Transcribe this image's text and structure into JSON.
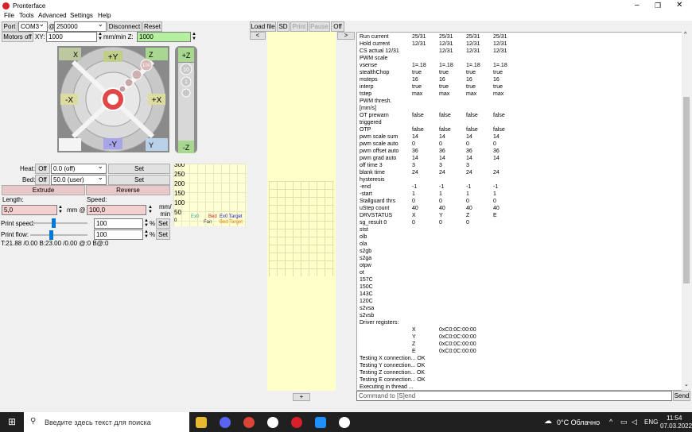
{
  "window": {
    "title": "Pronterface"
  },
  "menu": [
    "File",
    "Tools",
    "Advanced",
    "Settings",
    "Help"
  ],
  "toolbar": {
    "port_label": "Port",
    "port_value": "COM3",
    "baud_at": "@",
    "baud_value": "250000",
    "disconnect": "Disconnect",
    "reset": "Reset",
    "load_file": "Load file",
    "sd": "SD",
    "print": "Print",
    "pause": "Pause",
    "off": "Off"
  },
  "motion": {
    "motors_off": "Motors off",
    "xy_label": "XY:",
    "xy_feed": "1000",
    "z_unit": "mm/min Z:",
    "z_feed": "1000",
    "btn_home_x": "X",
    "btn_home_z": "Z",
    "btn_home_y": "Y",
    "btn_plus_y": "+Y",
    "btn_minus_y": "-Y",
    "btn_plus_x": "+X",
    "btn_minus_x": "-X",
    "btn_plus_z": "+Z",
    "btn_minus_z": "-Z",
    "steps": [
      "100",
      "10",
      "1",
      "0.1"
    ],
    "z_steps": [
      "10",
      "1",
      "0.1"
    ]
  },
  "temp": {
    "heat_label": "Heat:",
    "heat_off": "Off",
    "heat_value": "0.0 (off)",
    "heat_set": "Set",
    "bed_label": "Bed:",
    "bed_off": "Off",
    "bed_value": "50.0 (user)",
    "bed_set": "Set",
    "extrude": "Extrude",
    "reverse": "Reverse",
    "length_label": "Length:",
    "speed_label": "Speed:",
    "length_value": "5,0",
    "mm_at": "mm @",
    "speed_value": "100,0",
    "speed_unit_1": "mm/",
    "speed_unit_2": "min",
    "print_speed_label": "Print speed:",
    "print_speed_value": "100",
    "print_flow_label": "Print flow:",
    "print_flow_value": "100",
    "pct": "%",
    "set": "Set",
    "status": "T:21.88 /0.00 B:23.00 /0.00 @:0 B@:0"
  },
  "graph": {
    "yticks": [
      "300",
      "250",
      "200",
      "150",
      "100",
      "50",
      "0"
    ],
    "legend": [
      "Ex0",
      "Bed",
      "Ex0 Target",
      "Fan",
      "Bed Target"
    ]
  },
  "viewer": {
    "left_arrow": "<",
    "right_arrow": ">",
    "plus": "+"
  },
  "log": {
    "lines": [
      [
        "Run current",
        "25/31",
        "25/31",
        "25/31",
        "25/31"
      ],
      [
        "Hold current",
        "12/31",
        "12/31",
        "12/31",
        "12/31"
      ],
      [
        "CS actual  12/31",
        "",
        "12/31",
        "12/31",
        "12/31"
      ],
      [
        "PWM scale",
        "",
        "",
        "",
        ""
      ],
      [
        "vsense",
        "1=.18",
        "1=.18",
        "1=.18",
        "1=.18"
      ],
      [
        "stealthChop",
        "true",
        "true",
        "true",
        "true"
      ],
      [
        "msteps",
        "16",
        "16",
        "16",
        "16"
      ],
      [
        "interp",
        "true",
        "true",
        "true",
        "true"
      ],
      [
        "tstep",
        "max",
        "max",
        "max",
        "max"
      ],
      [
        "PWM thresh.",
        "",
        "",
        "",
        ""
      ],
      [
        "[mm/s]",
        "",
        "",
        "",
        ""
      ],
      [
        "OT prewarn",
        "false",
        "false",
        "false",
        "false"
      ],
      [
        "triggered",
        "",
        "",
        "",
        ""
      ],
      [
        " OTP",
        "false",
        "false",
        "false",
        "false"
      ],
      [
        "pwm scale sum",
        "14",
        "14",
        "14",
        "14"
      ],
      [
        "pwm scale auto",
        "0",
        "0",
        "0",
        "0"
      ],
      [
        "pwm offset auto",
        "36",
        "36",
        "36",
        "36"
      ],
      [
        "pwm grad auto",
        "14",
        "14",
        "14",
        "14"
      ],
      [
        "off time   3",
        "3",
        "3",
        "3",
        ""
      ],
      [
        "blank time",
        "24",
        "24",
        "24",
        "24"
      ],
      [
        "hysteresis",
        "",
        "",
        "",
        ""
      ],
      [
        " -end",
        "-1",
        "-1",
        "-1",
        "-1"
      ],
      [
        " -start",
        "1",
        "1",
        "1",
        "1"
      ],
      [
        "Stallguard thrs",
        "0",
        "0",
        "0",
        "0"
      ],
      [
        "uStep count",
        "40",
        "40",
        "40",
        "40"
      ],
      [
        "DRVSTATUS",
        "X",
        "Y",
        "Z",
        "E"
      ],
      [
        "sg_result  0",
        "0",
        "0",
        "0",
        ""
      ],
      [
        "stst",
        "",
        "",
        "",
        ""
      ],
      [
        "olb",
        "",
        "",
        "",
        ""
      ],
      [
        "ola",
        "",
        "",
        "",
        ""
      ],
      [
        "s2gb",
        "",
        "",
        "",
        ""
      ],
      [
        "s2ga",
        "",
        "",
        "",
        ""
      ],
      [
        "otpw",
        "",
        "",
        "",
        ""
      ],
      [
        "ot",
        "",
        "",
        "",
        ""
      ],
      [
        "157C",
        "",
        "",
        "",
        ""
      ],
      [
        "150C",
        "",
        "",
        "",
        ""
      ],
      [
        "143C",
        "",
        "",
        "",
        ""
      ],
      [
        "120C",
        "",
        "",
        "",
        ""
      ],
      [
        "s2vsa",
        "",
        "",
        "",
        ""
      ],
      [
        "s2vsb",
        "",
        "",
        "",
        ""
      ],
      [
        "Driver registers:",
        "",
        "",
        "",
        ""
      ],
      [
        "",
        "X",
        "0xC0:0C:00:00",
        "",
        ""
      ],
      [
        "",
        "Y",
        "0xC0:0C:00:00",
        "",
        ""
      ],
      [
        "",
        "Z",
        "0xC0:0C:00:00",
        "",
        ""
      ],
      [
        "",
        "E",
        "0xC0:0C:00:00",
        "",
        ""
      ],
      [
        "Testing X connection... OK",
        "",
        "",
        "",
        ""
      ],
      [
        "Testing Y connection... OK",
        "",
        "",
        "",
        ""
      ],
      [
        "Testing Z connection... OK",
        "",
        "",
        "",
        ""
      ],
      [
        "Testing E connection... OK",
        "",
        "",
        "",
        ""
      ],
      [
        "Executing in thread ...",
        "",
        "",
        "",
        ""
      ]
    ]
  },
  "command": {
    "placeholder": "Command to [S]end",
    "send": "Send"
  },
  "taskbar": {
    "search_placeholder": "Введите здесь текст для поиска",
    "weather": "0°C Облачно",
    "lang": "ENG",
    "time": "11:54",
    "date": "07.03.2022"
  }
}
